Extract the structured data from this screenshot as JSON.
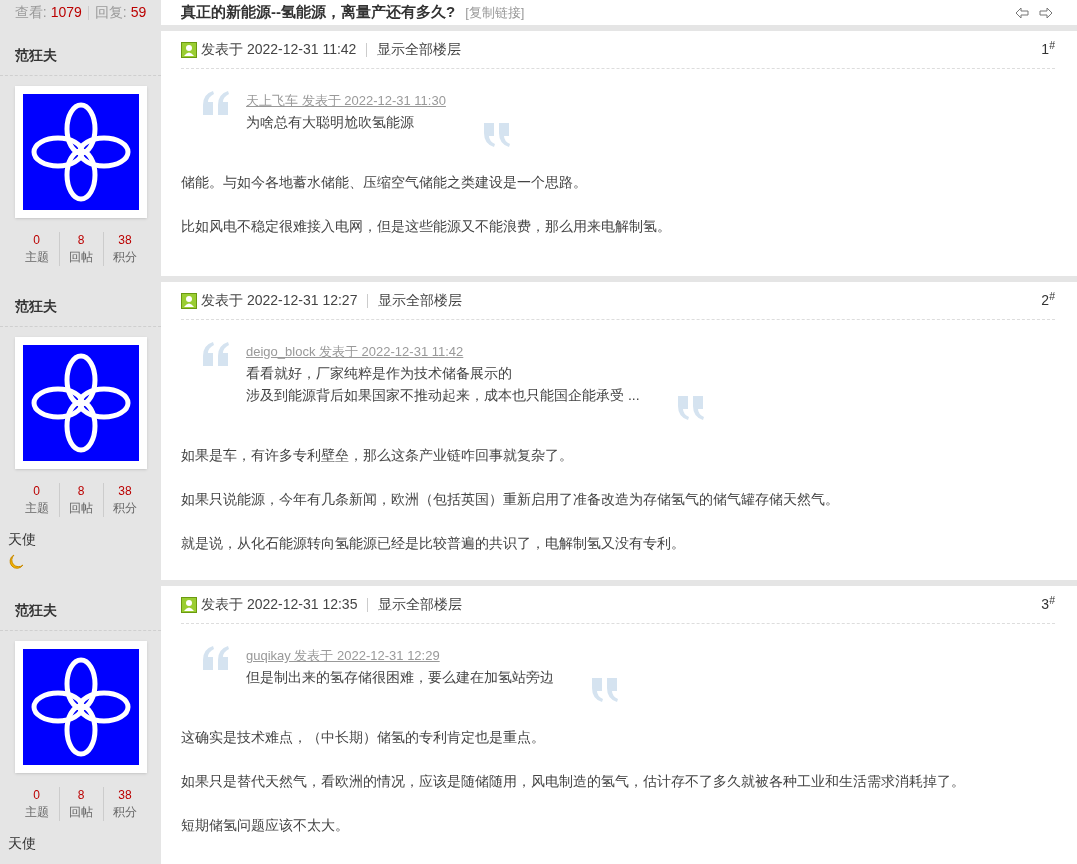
{
  "stats": {
    "views_label": "查看:",
    "views": "1079",
    "replies_label": "回复:",
    "replies": "59"
  },
  "thread": {
    "title": "真正的新能源--氢能源，离量产还有多久?",
    "copy_link": "[复制链接]"
  },
  "posts": [
    {
      "author": "范狂夫",
      "stats": [
        {
          "value": "0",
          "label": "主题"
        },
        {
          "value": "8",
          "label": "回帖"
        },
        {
          "value": "38",
          "label": "积分"
        }
      ],
      "posted": "发表于 2022-12-31 11:42",
      "show_all": "显示全部楼层",
      "floor": "1$^{#}$",
      "quote": {
        "source": "天上飞车 发表于 2022-12-31 11:30",
        "lines": [
          "为啥总有大聪明尬吹氢能源"
        ]
      },
      "paragraphs": [
        "储能。与如今各地蓄水储能、压缩空气储能之类建设是一个思路。",
        "比如风电不稳定很难接入电网，但是这些能源又不能浪费，那么用来电解制氢。"
      ]
    },
    {
      "author": "范狂夫",
      "stats": [
        {
          "value": "0",
          "label": "主题"
        },
        {
          "value": "8",
          "label": "回帖"
        },
        {
          "value": "38",
          "label": "积分"
        }
      ],
      "rank": "天使",
      "rank_moon": true,
      "posted": "发表于 2022-12-31 12:27",
      "show_all": "显示全部楼层",
      "floor": "2$^{#}$",
      "quote": {
        "source": "deigo_block 发表于 2022-12-31 11:42",
        "lines": [
          "看看就好，厂家纯粹是作为技术储备展示的",
          "涉及到能源背后如果国家不推动起来，成本也只能国企能承受 ..."
        ]
      },
      "paragraphs": [
        "如果是车，有许多专利壁垒，那么这条产业链咋回事就复杂了。",
        "如果只说能源，今年有几条新闻，欧洲（包括英国）重新启用了准备改造为存储氢气的储气罐存储天然气。",
        "就是说，从化石能源转向氢能源已经是比较普遍的共识了，电解制氢又没有专利。"
      ]
    },
    {
      "author": "范狂夫",
      "stats": [
        {
          "value": "0",
          "label": "主题"
        },
        {
          "value": "8",
          "label": "回帖"
        },
        {
          "value": "38",
          "label": "积分"
        }
      ],
      "rank": "天使",
      "posted": "发表于 2022-12-31 12:35",
      "show_all": "显示全部楼层",
      "floor": "3$^{#}$",
      "quote": {
        "source": "guqikay 发表于 2022-12-31 12:29",
        "lines": [
          "但是制出来的氢存储很困难，要么建在加氢站旁边"
        ]
      },
      "paragraphs": [
        "这确实是技术难点，（中长期）储氢的专利肯定也是重点。",
        "如果只是替代天然气，看欧洲的情况，应该是随储随用，风电制造的氢气，估计存不了多久就被各种工业和生活需求消耗掉了。",
        "短期储氢问题应该不太大。"
      ]
    }
  ]
}
